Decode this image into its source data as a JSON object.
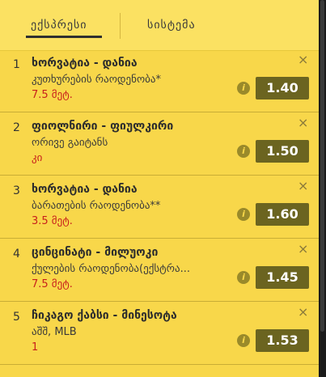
{
  "tabs": {
    "express": "ექსპრესი",
    "system": "სისტემა"
  },
  "bets": [
    {
      "num": "1",
      "match": "ხორვატია - დანია",
      "market": "კუთხურების რაოდენობა*",
      "pick": "7.5 მეტ.",
      "odds": "1.40"
    },
    {
      "num": "2",
      "match": "ფიოლნირი - ფიულკირი",
      "market": "ორივე გაიტანს",
      "pick": "კი",
      "odds": "1.50"
    },
    {
      "num": "3",
      "match": "ხორვატია - დანია",
      "market": "ბარათების რაოდენობა**",
      "pick": "3.5 მეტ.",
      "odds": "1.60"
    },
    {
      "num": "4",
      "match": "ცინცინატი - მილუოკი",
      "market": "ქულების რაოდენობა(ექსტრა...",
      "pick": "7.5 მეტ.",
      "odds": "1.45"
    },
    {
      "num": "5",
      "match": "ჩიკაგო ქაბსი - მინესოტა",
      "market": "აშშ, MLB",
      "pick": "1",
      "odds": "1.53"
    }
  ],
  "icons": {
    "close": "×",
    "info": "i"
  },
  "colors": {
    "accent": "#f8d74a",
    "odds_button": "#6b6420",
    "pick_text": "#c8201c"
  }
}
